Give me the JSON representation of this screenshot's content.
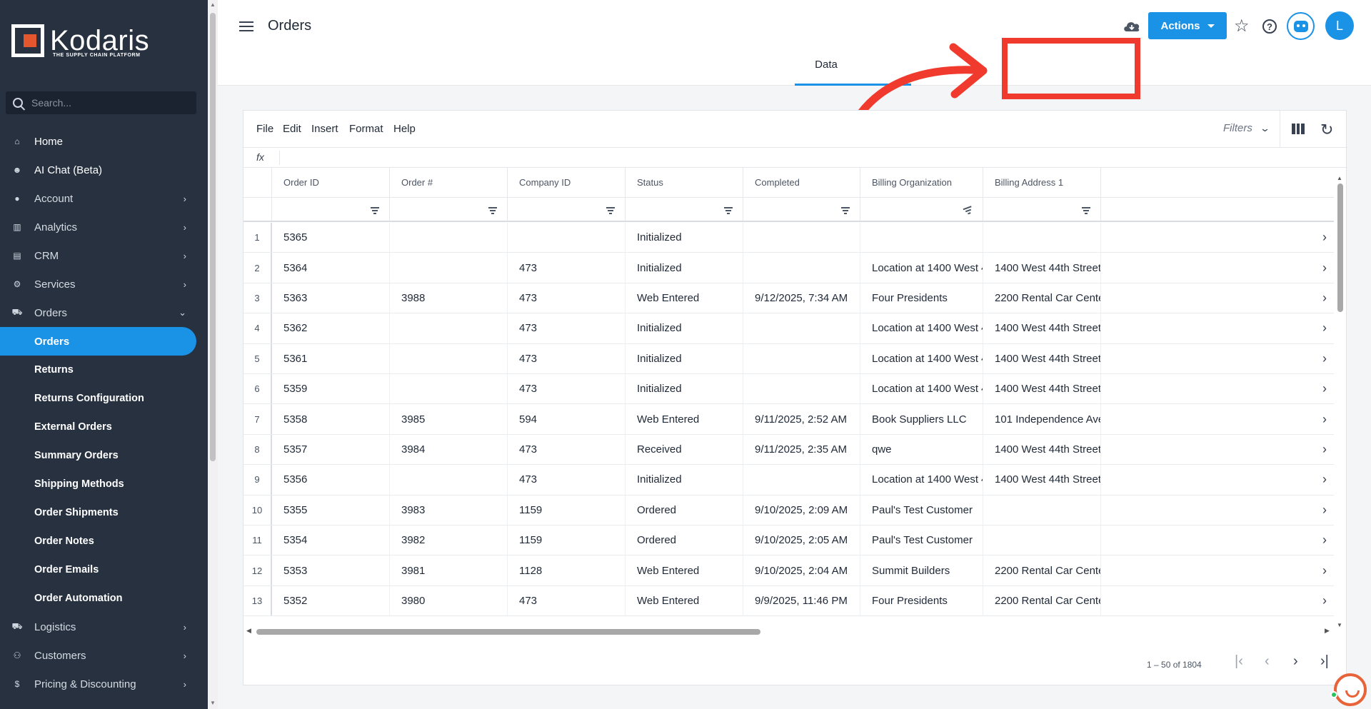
{
  "brand": {
    "name": "Kodaris",
    "tagline": "THE SUPPLY CHAIN PLATFORM"
  },
  "search": {
    "placeholder": "Search..."
  },
  "sidebar": {
    "items": [
      {
        "label": "Home",
        "icon": "home-icon",
        "kind": "top"
      },
      {
        "label": "AI Chat (Beta)",
        "icon": "robot-icon",
        "kind": "top"
      },
      {
        "label": "Account",
        "icon": "person-icon",
        "kind": "group",
        "chevron": "›"
      },
      {
        "label": "Analytics",
        "icon": "chart-icon",
        "kind": "group",
        "chevron": "›"
      },
      {
        "label": "CRM",
        "icon": "contact-card-icon",
        "kind": "group",
        "chevron": "›"
      },
      {
        "label": "Services",
        "icon": "services-icon",
        "kind": "group",
        "chevron": "›"
      },
      {
        "label": "Orders",
        "icon": "truck-icon",
        "kind": "group",
        "chevron": "⌄"
      },
      {
        "label": "Orders",
        "kind": "active"
      },
      {
        "label": "Returns",
        "kind": "sub"
      },
      {
        "label": "Returns Configuration",
        "kind": "sub"
      },
      {
        "label": "External Orders",
        "kind": "sub"
      },
      {
        "label": "Summary Orders",
        "kind": "sub"
      },
      {
        "label": "Shipping Methods",
        "kind": "sub"
      },
      {
        "label": "Order Shipments",
        "kind": "sub"
      },
      {
        "label": "Order Notes",
        "kind": "sub"
      },
      {
        "label": "Order Emails",
        "kind": "sub"
      },
      {
        "label": "Order Automation",
        "kind": "sub"
      },
      {
        "label": "Logistics",
        "icon": "logistics-icon",
        "kind": "group",
        "chevron": "›"
      },
      {
        "label": "Customers",
        "icon": "people-icon",
        "kind": "group",
        "chevron": "›"
      },
      {
        "label": "Pricing & Discounting",
        "icon": "dollar-icon",
        "kind": "group",
        "chevron": "›"
      }
    ]
  },
  "header": {
    "title": "Orders",
    "actions_label": "Actions",
    "avatar_initial": "L",
    "tab_label": "Data"
  },
  "grid_menu": [
    "File",
    "Edit",
    "Insert",
    "Format",
    "Help"
  ],
  "filters_label": "Filters",
  "fx_label": "fx",
  "columns": [
    "Order ID",
    "Order #",
    "Company ID",
    "Status",
    "Completed",
    "Billing Organization",
    "Billing Address 1"
  ],
  "rows": [
    [
      "1",
      "5365",
      "",
      "",
      "Initialized",
      "",
      "",
      ""
    ],
    [
      "2",
      "5364",
      "",
      "473",
      "Initialized",
      "",
      "Location at 1400 West 4...",
      "1400 West 44th Street"
    ],
    [
      "3",
      "5363",
      "3988",
      "473",
      "Web Entered",
      "9/12/2025, 7:34 AM",
      "Four Presidents",
      "2200 Rental Car Center ..."
    ],
    [
      "4",
      "5362",
      "",
      "473",
      "Initialized",
      "",
      "Location at 1400 West 4...",
      "1400 West 44th Street"
    ],
    [
      "5",
      "5361",
      "",
      "473",
      "Initialized",
      "",
      "Location at 1400 West 4...",
      "1400 West 44th Street"
    ],
    [
      "6",
      "5359",
      "",
      "473",
      "Initialized",
      "",
      "Location at 1400 West 4...",
      "1400 West 44th Street"
    ],
    [
      "7",
      "5358",
      "3985",
      "594",
      "Web Entered",
      "9/11/2025, 2:52 AM",
      "Book Suppliers LLC",
      "101 Independence Ave. ..."
    ],
    [
      "8",
      "5357",
      "3984",
      "473",
      "Received",
      "9/11/2025, 2:35 AM",
      "qwe",
      "1400 West 44th Street"
    ],
    [
      "9",
      "5356",
      "",
      "473",
      "Initialized",
      "",
      "Location at 1400 West 4...",
      "1400 West 44th Street"
    ],
    [
      "10",
      "5355",
      "3983",
      "1159",
      "Ordered",
      "9/10/2025, 2:09 AM",
      "Paul's Test Customer",
      ""
    ],
    [
      "11",
      "5354",
      "3982",
      "1159",
      "Ordered",
      "9/10/2025, 2:05 AM",
      "Paul's Test Customer",
      ""
    ],
    [
      "12",
      "5353",
      "3981",
      "1128",
      "Web Entered",
      "9/10/2025, 2:04 AM",
      "Summit Builders",
      "2200 Rental Car Center ..."
    ],
    [
      "13",
      "5352",
      "3980",
      "473",
      "Web Entered",
      "9/9/2025, 11:46 PM",
      "Four Presidents",
      "2200 Rental Car Center ..."
    ]
  ],
  "pager": {
    "text": "1 – 50 of 1804"
  },
  "colors": {
    "accent": "#1a92e6",
    "sidebar_bg": "#273140",
    "annotation": "#f03a2e"
  }
}
